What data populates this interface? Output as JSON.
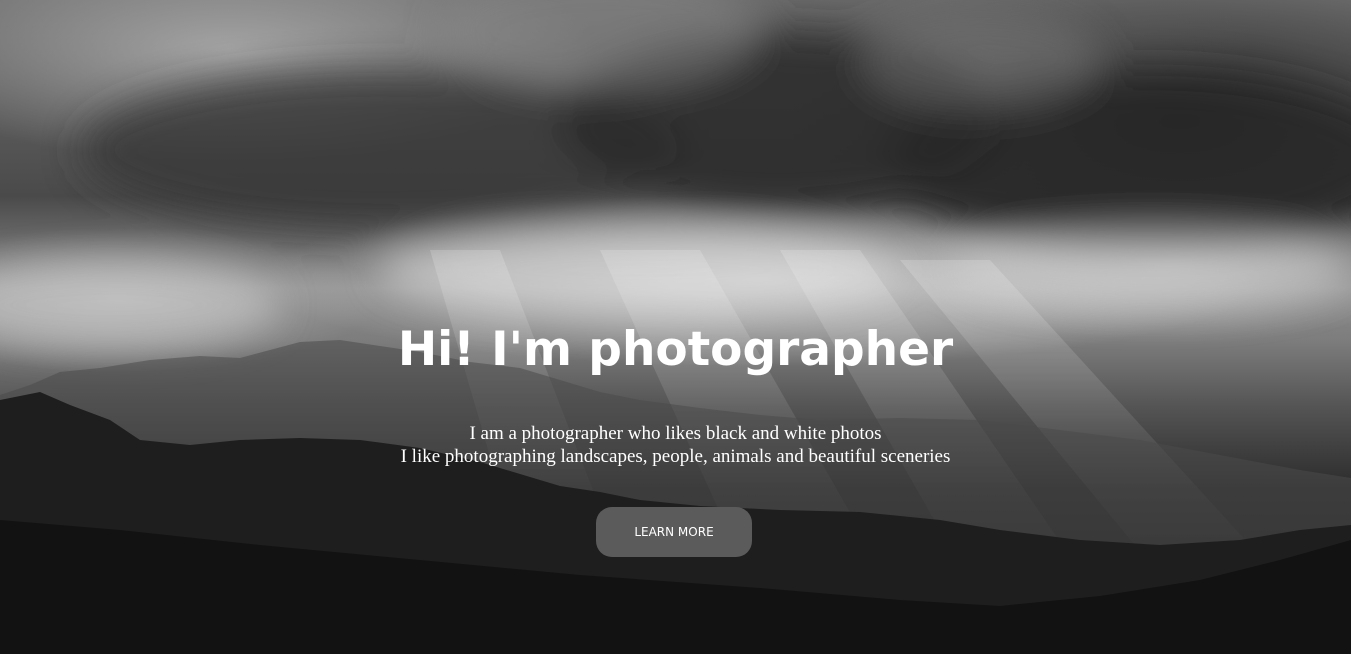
{
  "hero": {
    "title": "Hi! I'm photographer",
    "subtitle_line_1": "I am a photographer who likes black and white photos",
    "subtitle_line_2": "I like photographing landscapes, people, animals and beautiful sceneries",
    "button_label": "LEARN MORE"
  },
  "colors": {
    "text": "#ffffff",
    "button_bg": "#5b5b5b",
    "dark_ground": "#111111"
  }
}
